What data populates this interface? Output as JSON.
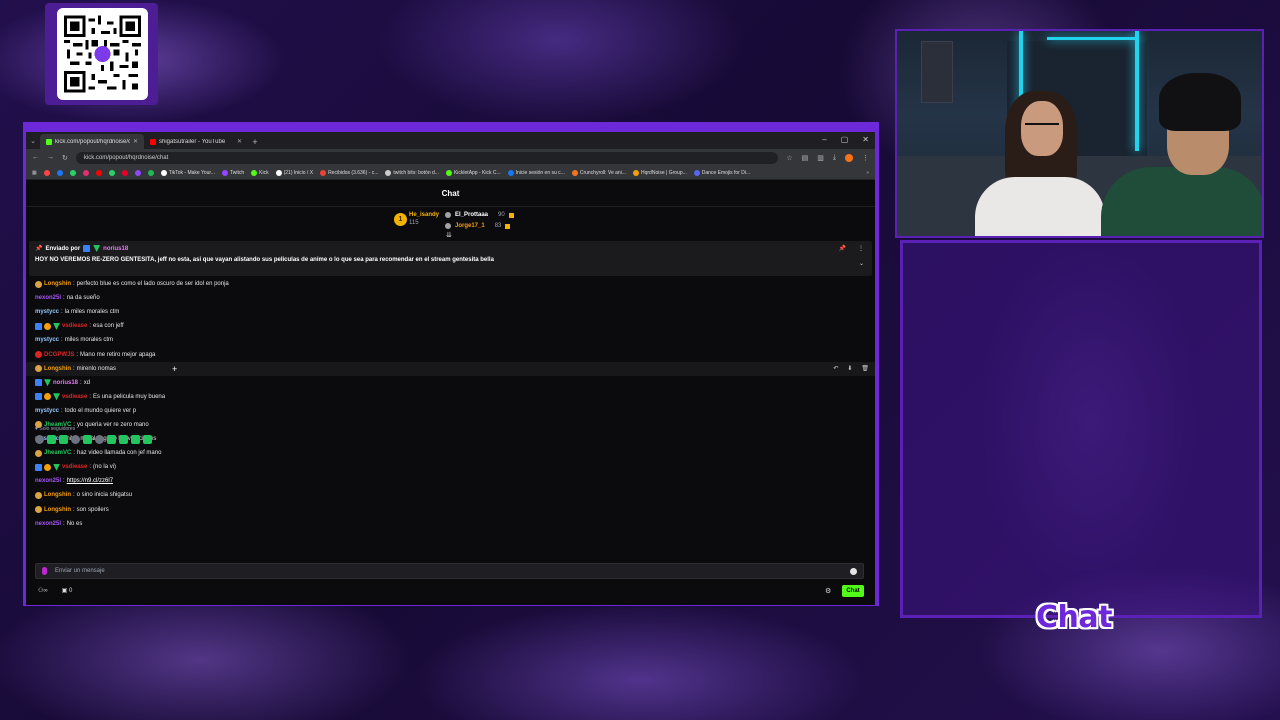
{
  "browser": {
    "tabs": [
      {
        "title": "kick.com/popout/hqrdnoise/ch",
        "favicon_color": "#53fc18",
        "active": true
      },
      {
        "title": "shigatsutrailer - YouTube",
        "favicon_color": "#ff0000",
        "active": false
      }
    ],
    "url": "kick.com/popout/hqrdnoise/chat",
    "bookmarks": [
      {
        "label": "TikTok - Make Your...",
        "color": "#ffffff"
      },
      {
        "label": "Twitch",
        "color": "#9146ff"
      },
      {
        "label": "Kick",
        "color": "#53fc18"
      },
      {
        "label": "(21) Inicio / X",
        "color": "#ffffff"
      },
      {
        "label": "Recibidos (3.636) - c...",
        "color": "#ea4335"
      },
      {
        "label": "twitch bits: botón d...",
        "color": "#cccccc"
      },
      {
        "label": "KickletApp - Kick C...",
        "color": "#53fc18"
      },
      {
        "label": "Inicie sesión en su c...",
        "color": "#1877f2"
      },
      {
        "label": "Crunchyroll: Ve ani...",
        "color": "#f47521"
      },
      {
        "label": "HqrdNoise | Group...",
        "color": "#f59e0b"
      },
      {
        "label": "Dance Emojis for Di...",
        "color": "#5865f2"
      }
    ]
  },
  "chat": {
    "header": "Chat",
    "leaderboard": {
      "first": {
        "name": "He_isandy",
        "score": "115"
      },
      "second": {
        "name": "El_Prottaaa",
        "score": "90"
      },
      "third": {
        "name": "Jorge17_1",
        "score": "83"
      }
    },
    "pinned": {
      "sent_by": "Enviado por",
      "user": "norius18",
      "message": "HOY NO VEREMOS RE-ZERO GENTESITA, jeff no esta, asi que vayan alistando sus peliculas de anime o lo que sea para recomendar en el stream gentesita bella"
    },
    "messages": [
      {
        "badges": [
          "face"
        ],
        "user": "Longshin",
        "color": "#f59e0b",
        "text": "perfecto blue es como el lado oscuro de ser idol en ponja"
      },
      {
        "badges": [],
        "user": "nexon25l",
        "color": "#a855f7",
        "text": "na da sueño"
      },
      {
        "badges": [],
        "user": "mystycc",
        "color": "#93c5fd",
        "text": "la miles morales ctm"
      },
      {
        "badges": [
          "blue",
          "gold",
          "green"
        ],
        "user": "vsdiease",
        "color": "#dc2626",
        "text": "esa con jeff"
      },
      {
        "badges": [],
        "user": "mystycc",
        "color": "#93c5fd",
        "text": "miles morales ctm"
      },
      {
        "badges": [
          "red"
        ],
        "user": "DCGPWJS",
        "color": "#dc2626",
        "text": "Mano me retiro mejor apaga"
      },
      {
        "badges": [
          "face"
        ],
        "user": "Longshin",
        "color": "#f59e0b",
        "text": "mirenlo nomas"
      },
      {
        "badges": [
          "blue",
          "green"
        ],
        "user": "norius18",
        "color": "#e879f9",
        "text": "xd"
      },
      {
        "badges": [
          "blue",
          "gold",
          "green"
        ],
        "user": "vsdiease",
        "color": "#dc2626",
        "text": "Es una pelicula muy buena"
      },
      {
        "badges": [],
        "user": "mystycc",
        "color": "#93c5fd",
        "text": "todo el mundo quiere ver p"
      },
      {
        "badges": [
          "face"
        ],
        "user": "JheamVC",
        "color": "#22c55e",
        "text": "yo queria ver re zero mano"
      },
      {
        "badges": [],
        "user": "mystycc",
        "color": "#93c5fd",
        "text": "miles morales gano las votaciones"
      },
      {
        "badges": [
          "face"
        ],
        "user": "JheamVC",
        "color": "#22c55e",
        "text": "haz video llamada con jef mano"
      },
      {
        "badges": [
          "blue",
          "gold",
          "green"
        ],
        "user": "vsdiease",
        "color": "#dc2626",
        "text": "(no la vi)"
      },
      {
        "badges": [],
        "user": "nexon25l",
        "color": "#a855f7",
        "text": "https://n9.cl/zz6l7",
        "is_link": true
      },
      {
        "badges": [
          "face"
        ],
        "user": "Longshin",
        "color": "#f59e0b",
        "text": "o sino inicia shigatsu"
      },
      {
        "badges": [
          "face"
        ],
        "user": "Longshin",
        "color": "#f59e0b",
        "text": "son spoilers"
      },
      {
        "badges": [],
        "user": "nexon25l",
        "color": "#a855f7",
        "text": "No es"
      }
    ],
    "followers_only": "Solo seguidores",
    "input_placeholder": "Enviar un mensaje",
    "footer": {
      "viewers": "0",
      "chat_button": "Chat"
    }
  },
  "overlay": {
    "label": "Chat"
  },
  "colors": {
    "accent": "#53fc18",
    "frame": "#6d28d9"
  }
}
